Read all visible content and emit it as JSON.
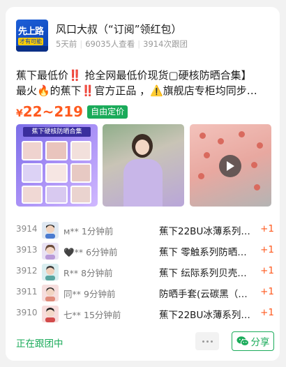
{
  "header": {
    "logo_text_1": "先上路",
    "logo_text_2": "才有可能",
    "author": "风口大叔（“订阅”领红包）",
    "time_ago": "5天前",
    "views": "69035人查看",
    "follows": "3914次跟团"
  },
  "post": {
    "line1": "蕉下最低价‼️ 抢全网最低价现货▢硬核防晒合集】",
    "line2": "最火🔥的蕉下‼️官方正品 ，⚠️旗舰店专柜均同步…",
    "price_symbol": "¥",
    "price_range": "22~219",
    "price_tag": "自由定价"
  },
  "images": {
    "img1_title": "蕉下硬核防晒合集"
  },
  "followers": [
    {
      "num": "3914",
      "name": "ᴍ**",
      "time": "1分钟前",
      "item": "蕉下22BU冰薄系列…",
      "qty": "+1"
    },
    {
      "num": "3913",
      "name": "🖤**",
      "time": "6分钟前",
      "item": "蕉下 零触系列防晒…",
      "qty": "+1"
    },
    {
      "num": "3912",
      "name": "R**",
      "time": "8分钟前",
      "item": "蕉下 纭际系列贝壳…",
      "qty": "+1"
    },
    {
      "num": "3911",
      "name": "同**",
      "time": "9分钟前",
      "item": "防晒手套(云碳黑（…",
      "qty": "+1"
    },
    {
      "num": "3910",
      "name": "七**",
      "time": "15分钟前",
      "item": "蕉下22BU冰薄系列…",
      "qty": "+1"
    }
  ],
  "footer": {
    "status": "正在跟团中",
    "share_label": "分享"
  },
  "colors": {
    "accent_green": "#1aab5a",
    "price_orange": "#ff5a1f"
  }
}
